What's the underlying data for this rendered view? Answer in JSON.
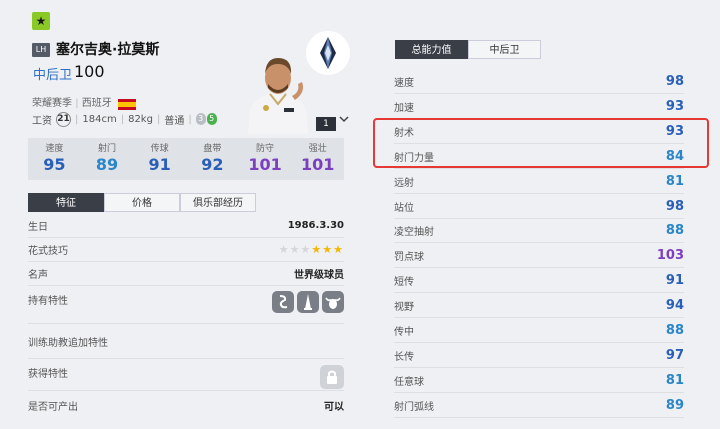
{
  "card": {
    "star_glyph": "★",
    "pos_chip": "LH",
    "name": "塞尔吉奥·拉莫斯",
    "position": "中后卫",
    "overall": "100",
    "season": "荣耀赛季",
    "nation": "西班牙",
    "wage_label": "工资",
    "wage": "21",
    "height": "184cm",
    "weight": "82kg",
    "body": "普通",
    "weak_foot": "3",
    "strong_foot": "5",
    "level": "1"
  },
  "stats": [
    {
      "label": "速度",
      "value": "95",
      "color": "#2a5fb8"
    },
    {
      "label": "射门",
      "value": "89",
      "color": "#2a86c9"
    },
    {
      "label": "传球",
      "value": "91",
      "color": "#2a5fb8"
    },
    {
      "label": "盘带",
      "value": "92",
      "color": "#2a5fb8"
    },
    {
      "label": "防守",
      "value": "101",
      "color": "#7b3fbf"
    },
    {
      "label": "强壮",
      "value": "101",
      "color": "#7b3fbf"
    }
  ],
  "left_tabs": [
    "特征",
    "价格",
    "俱乐部经历"
  ],
  "info": {
    "birth_label": "生日",
    "birth": "1986.3.30",
    "skill_label": "花式技巧",
    "skill_stars": 3,
    "rep_label": "名声",
    "rep": "世界级球员",
    "traits_label": "持有特性",
    "trained_label": "训练助教追加特性",
    "earned_label": "获得特性",
    "sellable_label": "是否可产出",
    "sellable": "可以"
  },
  "right_tabs": [
    "总能力值",
    "中后卫"
  ],
  "attributes": [
    {
      "label": "速度",
      "value": "98",
      "color": "#2a5fb8"
    },
    {
      "label": "加速",
      "value": "93",
      "color": "#2a5fb8"
    },
    {
      "label": "射术",
      "value": "93",
      "color": "#2a5fb8"
    },
    {
      "label": "射门力量",
      "value": "84",
      "color": "#2a86c9"
    },
    {
      "label": "远射",
      "value": "81",
      "color": "#2a86c9"
    },
    {
      "label": "站位",
      "value": "98",
      "color": "#2a5fb8"
    },
    {
      "label": "凌空抽射",
      "value": "88",
      "color": "#2a86c9"
    },
    {
      "label": "罚点球",
      "value": "103",
      "color": "#7b3fbf"
    },
    {
      "label": "短传",
      "value": "91",
      "color": "#2a5fb8"
    },
    {
      "label": "视野",
      "value": "94",
      "color": "#2a5fb8"
    },
    {
      "label": "传中",
      "value": "88",
      "color": "#2a86c9"
    },
    {
      "label": "长传",
      "value": "97",
      "color": "#2a5fb8"
    },
    {
      "label": "任意球",
      "value": "81",
      "color": "#2a86c9"
    },
    {
      "label": "射门弧线",
      "value": "89",
      "color": "#2a86c9"
    }
  ]
}
